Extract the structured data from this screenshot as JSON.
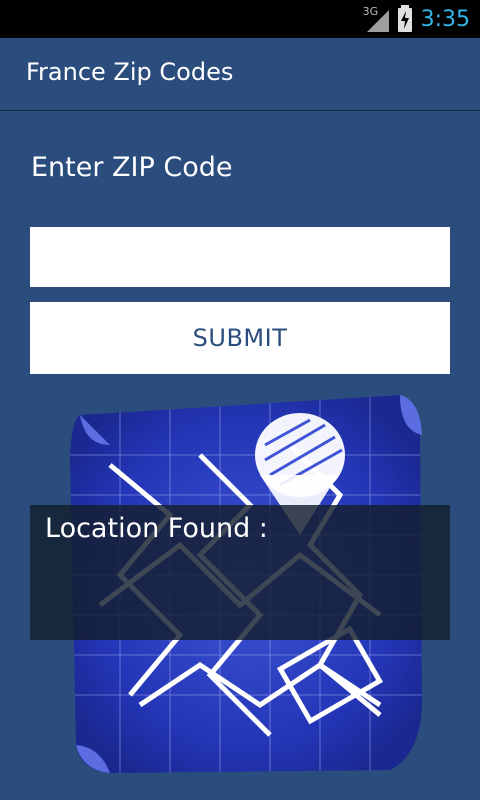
{
  "status_bar": {
    "network": "3G",
    "time": "3:35"
  },
  "app": {
    "title": "France Zip Codes"
  },
  "form": {
    "prompt": "Enter ZIP  Code",
    "zip_value": "",
    "submit_label": "SUBMIT"
  },
  "result": {
    "label": "Location Found :"
  },
  "colors": {
    "background": "#2b4d7e",
    "status_time": "#33b5e5",
    "button_text": "#2b4d7e"
  }
}
